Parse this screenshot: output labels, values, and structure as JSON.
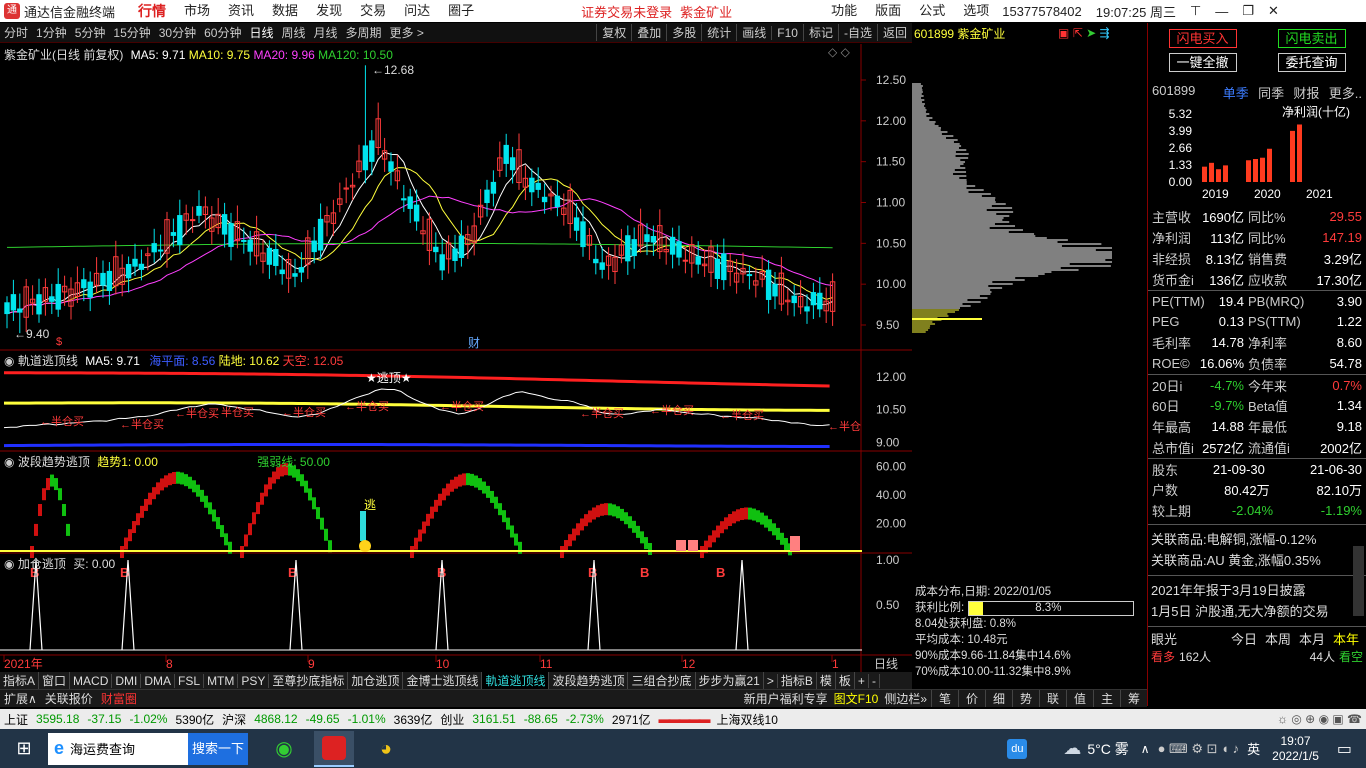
{
  "titlebar": {
    "app": "通达信金融终端",
    "menus": [
      "行情",
      "市场",
      "资讯",
      "数据",
      "发现",
      "交易",
      "问达",
      "圈子"
    ],
    "notice": "证券交易未登录",
    "stock_name": "紫金矿业",
    "right_menus": [
      "功能",
      "版面",
      "公式",
      "选项"
    ],
    "phone": "15377578402",
    "clock": "19:07:25 周三"
  },
  "period": {
    "items": [
      "分时",
      "1分钟",
      "5分钟",
      "15分钟",
      "30分钟",
      "60分钟",
      "日线",
      "周线",
      "月线",
      "多周期",
      "更多 >"
    ],
    "selected": "日线",
    "tools": [
      "复权",
      "叠加",
      "多股",
      "统计",
      "画线",
      "F10",
      "标记",
      "-自选",
      "返回"
    ]
  },
  "main_chart": {
    "title": "紫金矿业(日线 前复权)",
    "ma5": "MA5: 9.71",
    "ma10": "MA10: 9.75",
    "ma20": "MA20: 9.96",
    "ma120": "MA120: 10.50",
    "high_label": "12.68",
    "low_label": "9.40",
    "marker_dollar": "$",
    "marker_cai": "财",
    "yticks": [
      "12.50",
      "12.00",
      "11.50",
      "11.00",
      "10.50",
      "10.00",
      "9.50"
    ]
  },
  "chip_header": {
    "code": "601899",
    "name": "紫金矿业"
  },
  "panel2": {
    "title": "軌道逃顶线",
    "ma5": "MA5: 9.71",
    "sea": "海平面: 8.56",
    "land": "陆地: 10.62",
    "sky": "天空: 12.05",
    "top_label": "★逃顶★",
    "half_label": "半仓买",
    "half_label2": "←半仓",
    "yticks": [
      "12.00",
      "10.50",
      "9.00"
    ]
  },
  "panel3": {
    "title": "波段趋势逃顶",
    "trend": "趋势1: 0.00",
    "strong": "强弱线: 50.00",
    "b": "B",
    "escape": "逃",
    "yticks": [
      "60.00",
      "40.00",
      "20.00"
    ]
  },
  "panel4": {
    "title": "加仓逃顶",
    "buy": "买: 0.00",
    "yticks": [
      "1.00",
      "0.50"
    ]
  },
  "xaxis": {
    "labels": [
      "2021年",
      "8",
      "9",
      "10",
      "11",
      "12",
      "1"
    ],
    "right": "日线"
  },
  "indicator_tabs": [
    "指标A",
    "窗口",
    "MACD",
    "DMI",
    "DMA",
    "FSL",
    "MTM",
    "PSY",
    "至尊抄底指标",
    "加仓逃顶",
    "金博士逃顶线",
    "軌道逃顶线",
    "波段趋势逃顶",
    "三组合抄底",
    "步步为赢21",
    ">",
    "指标B",
    "模",
    "板",
    "+",
    "-"
  ],
  "selected_tab": "軌道逃顶线",
  "bottom_row": {
    "left": [
      "扩展∧",
      "关联报价",
      "财富圈"
    ],
    "right": [
      "新用户福利专享",
      "图文F10",
      "侧边栏»"
    ],
    "right_tabs": [
      "笔",
      "价",
      "细",
      "势",
      "联",
      "值",
      "主",
      "筹"
    ]
  },
  "chip_info": {
    "date": "成本分布,日期: 2022/01/05",
    "profit": "获利比例:",
    "profit_val": "8.3%",
    "profit_at": "8.04处获利盘: 0.8%",
    "avg": "平均成本: 10.48元",
    "c90": "90%成本9.66-11.84集中14.6%",
    "c70": "70%成本10.00-11.32集中8.9%"
  },
  "right_panel": {
    "buttons": [
      "闪电买入",
      "闪电卖出",
      "一键全撤",
      "委托查询"
    ],
    "fin_header": [
      "601899",
      "单季",
      "同季",
      "财报",
      "更多.."
    ],
    "fin_chart": {
      "yticks": [
        "5.32",
        "3.99",
        "2.66",
        "1.33",
        "0.00"
      ],
      "label": "净利润(十亿)",
      "years": [
        "2019",
        "2020",
        "2021"
      ],
      "values": [
        1.2,
        1.5,
        1.0,
        1.3,
        1.7,
        1.8,
        1.9,
        2.6,
        4.0,
        4.5
      ]
    },
    "rows": [
      [
        "主营收",
        "1690亿",
        "同比%",
        "29.55"
      ],
      [
        "净利润",
        "113亿",
        "同比%",
        "147.19"
      ],
      [
        "非经损",
        "8.13亿",
        "销售费",
        "3.29亿"
      ],
      [
        "货币金i",
        "136亿",
        "应收款",
        "17.30亿"
      ],
      [
        "PE(TTM)",
        "19.4",
        "PB(MRQ)",
        "3.90"
      ],
      [
        "PEG",
        "0.13",
        "PS(TTM)",
        "1.22"
      ],
      [
        "毛利率",
        "14.78",
        "净利率",
        "8.60"
      ],
      [
        "ROE©",
        "16.06%",
        "负债率",
        "54.78"
      ],
      [
        "20日i",
        "-4.7%",
        "今年来",
        "0.7%"
      ],
      [
        "60日",
        "-9.7%",
        "Beta值",
        "1.34"
      ],
      [
        "年最高",
        "14.88",
        "年最低",
        "9.18"
      ],
      [
        "总市值i",
        "2572亿",
        "流通值i",
        "2002亿"
      ],
      [
        "股东",
        "21-09-30",
        "",
        "21-06-30"
      ],
      [
        "户数",
        "80.42万",
        "",
        "82.10万"
      ],
      [
        "较上期",
        "-2.04%",
        "",
        "-1.19%"
      ]
    ],
    "related": [
      "关联商品:电解铜,涨幅-0.12%",
      "关联商品:AU 黄金,涨幅0.35%"
    ],
    "report": "2021年年报于3月19日披露",
    "hk": "1月5日 沪股通,无大净额的交易",
    "eye": {
      "label": "眼光",
      "tabs": [
        "今日",
        "本周",
        "本月",
        "本年"
      ],
      "bull": "看多",
      "bull_n": "162人",
      "bear_n": "44人",
      "bear": "看空"
    }
  },
  "status": {
    "sh": "上证",
    "sh_v": "3595.18",
    "sh_c": "-37.15",
    "sh_p": "-1.02%",
    "sh_a": "5390亿",
    "sz": "沪深",
    "sz_v": "4868.12",
    "sz_c": "-49.65",
    "sz_p": "-1.01%",
    "sz_a": "3639亿",
    "cy": "创业",
    "cy_v": "3161.51",
    "cy_c": "-88.65",
    "cy_p": "-2.73%",
    "cy_a": "2971亿",
    "line": "上海双线10"
  },
  "taskbar": {
    "search": "海运费查询",
    "search_btn": "搜索一下",
    "weather": "5°C 雾",
    "time": "19:07",
    "date": "2022/1/5",
    "du": "du",
    "ime": "英"
  }
}
